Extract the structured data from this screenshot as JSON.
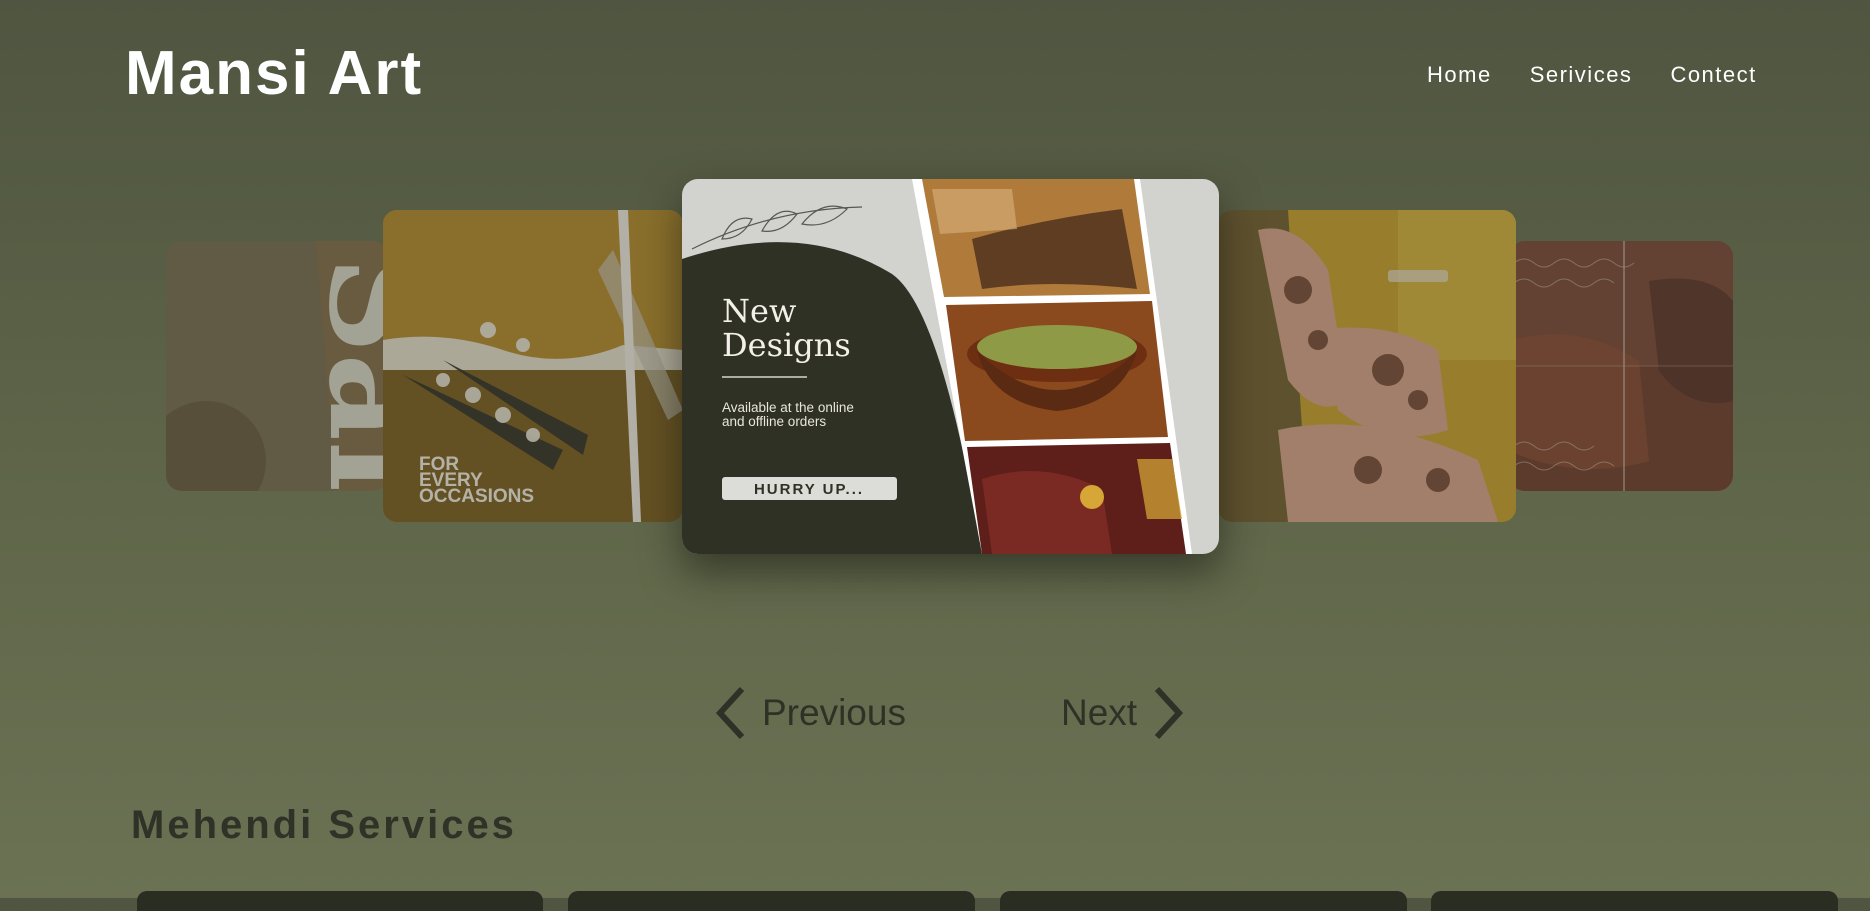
{
  "header": {
    "logo": "Mansi Art",
    "nav": [
      "Home",
      "Serivices",
      "Contect"
    ]
  },
  "carousel": {
    "far_left_card": {
      "text": "Sale"
    },
    "left_card": {
      "text_lines": [
        "FOR",
        "EVERY",
        "OCCASIONS"
      ]
    },
    "center_card": {
      "title_line1": "New",
      "title_line2": "Designs",
      "subtitle_line1": "Available at the online",
      "subtitle_line2": "and offline orders",
      "button": "HURRY UP..."
    },
    "previous_label": "Previous",
    "next_label": "Next"
  },
  "services": {
    "title": "Mehendi Services"
  },
  "colors": {
    "background": "#5f6649",
    "center_card_dark": "#2f3124",
    "accent_mustard": "#c9a02c"
  }
}
